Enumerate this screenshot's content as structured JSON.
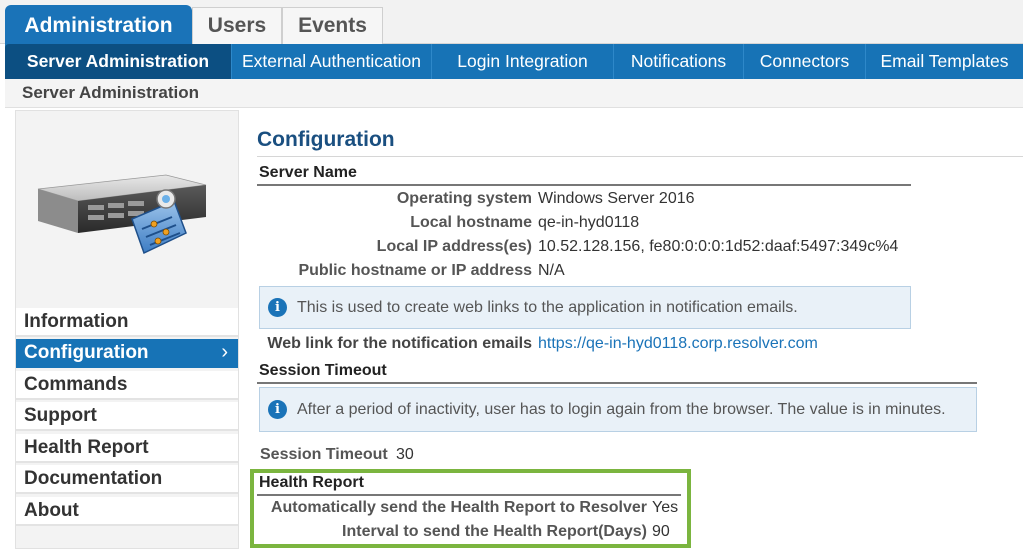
{
  "top_tabs": [
    "Administration",
    "Users",
    "Events"
  ],
  "sub_nav": [
    "Server Administration",
    "External Authentication",
    "Login Integration",
    "Notifications",
    "Connectors",
    "Email Templates"
  ],
  "breadcrumb": "Server Administration",
  "sidebar": {
    "items": [
      "Information",
      "Configuration",
      "Commands",
      "Support",
      "Health Report",
      "Documentation",
      "About"
    ],
    "active_chevron": "›"
  },
  "main": {
    "title": "Configuration",
    "server_name": {
      "heading": "Server Name",
      "fields": [
        {
          "label": "Operating system",
          "value": "Windows Server 2016"
        },
        {
          "label": "Local hostname",
          "value": "qe-in-hyd0118"
        },
        {
          "label": "Local IP address(es)",
          "value": "10.52.128.156, fe80:0:0:0:1d52:daaf:5497:349c%4"
        },
        {
          "label": "Public hostname or IP address",
          "value": "N/A"
        }
      ],
      "info": "This is used to create web links to the application in notification emails.",
      "web_link_label": "Web link for the notification emails",
      "web_link_value": "https://qe-in-hyd0118.corp.resolver.com"
    },
    "session_timeout": {
      "heading": "Session Timeout",
      "info": "After a period of inactivity, user has to login again from the browser. The value is in minutes.",
      "label": "Session Timeout",
      "value": "30"
    },
    "health_report": {
      "heading": "Health Report",
      "auto_send_label": "Automatically send the Health Report to Resolver",
      "auto_send_value": "Yes",
      "interval_label": "Interval to send the Health Report(Days)",
      "interval_value": "90"
    }
  },
  "colors": {
    "accent": "#1773b6",
    "active_sub": "#0c4f82",
    "highlight": "#7bb53f"
  },
  "icons": [
    "server-icon",
    "info-icon",
    "chevron-right-icon"
  ]
}
